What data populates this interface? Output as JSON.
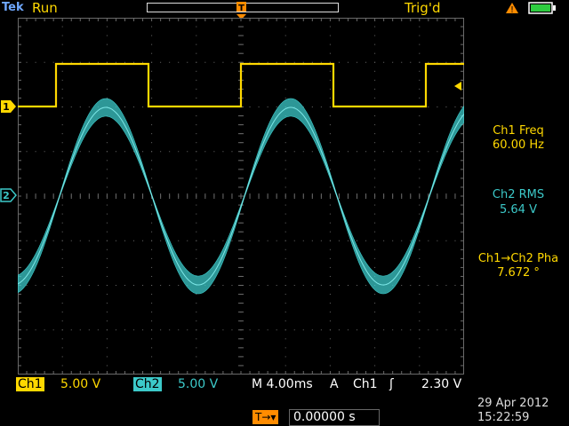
{
  "header": {
    "brand": "Tek",
    "run_state": "Run",
    "trigger_state": "Trig'd",
    "warning_symbol": "!",
    "trigger_marker": "T"
  },
  "colors": {
    "ch1": "#ffd800",
    "ch2": "#3cc9c9",
    "graticule": "#6a6a6a",
    "accent": "#ff8c00"
  },
  "markers": {
    "ch1": "1",
    "ch2": "2"
  },
  "measurements": [
    {
      "name": "Ch1 Freq",
      "value": "60.00 Hz",
      "channel": "ch1"
    },
    {
      "name": "Ch2 RMS",
      "value": "5.64 V",
      "channel": "ch2"
    },
    {
      "name_a": "Ch1",
      "arrow": "→",
      "name_b": "Ch2 Pha",
      "value": "7.672 °",
      "channel": "mixed"
    }
  ],
  "settings": {
    "ch1_label": "Ch1",
    "ch1_scale": "5.00 V",
    "ch2_label": "Ch2",
    "ch2_scale": "5.00 V",
    "timebase": "M 4.00ms",
    "trigger_mode": "A",
    "trigger_source": "Ch1",
    "trigger_slope": "ʃ",
    "trigger_level": "2.30 V"
  },
  "footer": {
    "trigger_offset_label": "T→▾",
    "trigger_offset": "0.00000 s",
    "date": "29 Apr 2012",
    "time": "15:22:59"
  }
}
